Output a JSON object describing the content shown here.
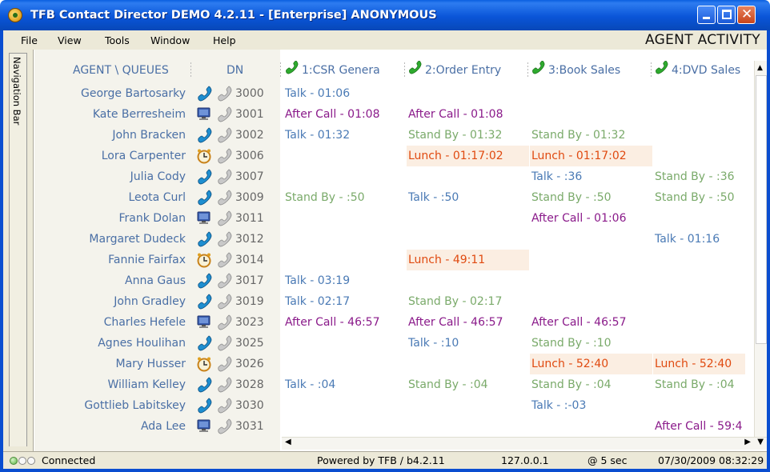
{
  "window": {
    "title": "TFB Contact Director DEMO 4.2.11 - [Enterprise] ANONYMOUS",
    "controls": {
      "minimize": "minimize",
      "maximize": "maximize",
      "close": "✕"
    }
  },
  "menu": {
    "items": [
      "File",
      "View",
      "Tools",
      "Window",
      "Help"
    ],
    "view_title": "AGENT ACTIVITY"
  },
  "navbar": {
    "label": "Navigation Bar"
  },
  "grid": {
    "headers": {
      "agent": "AGENT \\ QUEUES",
      "dn": "DN",
      "queues": [
        "1:CSR Genera",
        "2:Order Entry",
        "3:Book Sales",
        "4:DVD Sales"
      ]
    },
    "rows": [
      {
        "name": "George Bartosarky",
        "status": "phone-blue",
        "dn": "3000",
        "cells": [
          [
            "talk",
            "Talk - 01:06"
          ],
          null,
          null,
          null
        ]
      },
      {
        "name": "Kate Berresheim",
        "status": "monitor",
        "dn": "3001",
        "cells": [
          [
            "after",
            "After Call - 01:08"
          ],
          [
            "after",
            "After Call - 01:08"
          ],
          null,
          null
        ]
      },
      {
        "name": "John Bracken",
        "status": "phone-blue",
        "dn": "3002",
        "cells": [
          [
            "talk",
            "Talk - 01:32"
          ],
          [
            "standby",
            "Stand By - 01:32"
          ],
          [
            "standby",
            "Stand By - 01:32"
          ],
          null
        ]
      },
      {
        "name": "Lora Carpenter",
        "status": "clock",
        "dn": "3006",
        "cells": [
          null,
          [
            "lunch",
            "Lunch - 01:17:02"
          ],
          [
            "lunch",
            "Lunch - 01:17:02"
          ],
          null
        ]
      },
      {
        "name": "Julia Cody",
        "status": "phone-blue",
        "dn": "3007",
        "cells": [
          null,
          null,
          [
            "talk",
            "Talk - :36"
          ],
          [
            "standby",
            "Stand By - :36"
          ]
        ]
      },
      {
        "name": "Leota Curl",
        "status": "phone-blue",
        "dn": "3009",
        "cells": [
          [
            "standby",
            "Stand By - :50"
          ],
          [
            "talk",
            "Talk - :50"
          ],
          [
            "standby",
            "Stand By - :50"
          ],
          [
            "standby",
            "Stand By - :50"
          ]
        ]
      },
      {
        "name": "Frank Dolan",
        "status": "monitor",
        "dn": "3011",
        "cells": [
          null,
          null,
          [
            "after",
            "After Call - 01:06"
          ],
          null
        ]
      },
      {
        "name": "Margaret Dudeck",
        "status": "phone-blue",
        "dn": "3012",
        "cells": [
          null,
          null,
          null,
          [
            "talk",
            "Talk - 01:16"
          ]
        ]
      },
      {
        "name": "Fannie Fairfax",
        "status": "clock",
        "dn": "3014",
        "cells": [
          null,
          [
            "lunch",
            "Lunch - 49:11"
          ],
          null,
          null
        ]
      },
      {
        "name": "Anna Gaus",
        "status": "phone-blue",
        "dn": "3017",
        "cells": [
          [
            "talk",
            "Talk - 03:19"
          ],
          null,
          null,
          null
        ]
      },
      {
        "name": "John Gradley",
        "status": "phone-blue",
        "dn": "3019",
        "cells": [
          [
            "talk",
            "Talk - 02:17"
          ],
          [
            "standby",
            "Stand By - 02:17"
          ],
          null,
          null
        ]
      },
      {
        "name": "Charles Hefele",
        "status": "monitor",
        "dn": "3023",
        "cells": [
          [
            "after",
            "After Call - 46:57"
          ],
          [
            "after",
            "After Call - 46:57"
          ],
          [
            "after",
            "After Call - 46:57"
          ],
          null
        ]
      },
      {
        "name": "Agnes Houlihan",
        "status": "phone-blue",
        "dn": "3025",
        "cells": [
          null,
          [
            "talk",
            "Talk - :10"
          ],
          [
            "standby",
            "Stand By - :10"
          ],
          null
        ]
      },
      {
        "name": "Mary Husser",
        "status": "clock",
        "dn": "3026",
        "cells": [
          null,
          null,
          [
            "lunch",
            "Lunch - 52:40"
          ],
          [
            "lunch",
            "Lunch - 52:40"
          ]
        ]
      },
      {
        "name": "William Kelley",
        "status": "phone-blue",
        "dn": "3028",
        "cells": [
          [
            "talk",
            "Talk - :04"
          ],
          [
            "standby",
            "Stand By - :04"
          ],
          [
            "standby",
            "Stand By - :04"
          ],
          [
            "standby",
            "Stand By - :04"
          ]
        ]
      },
      {
        "name": "Gottlieb Labitskey",
        "status": "phone-blue",
        "dn": "3030",
        "cells": [
          null,
          null,
          [
            "talk",
            "Talk - :-03"
          ],
          null
        ]
      },
      {
        "name": "Ada Lee",
        "status": "monitor",
        "dn": "3031",
        "cells": [
          null,
          null,
          null,
          [
            "after",
            "After Call - 59:4"
          ]
        ]
      }
    ]
  },
  "statusbar": {
    "connection": "Connected",
    "powered": "Powered by TFB / b4.2.11",
    "host": "127.0.0.1",
    "refresh": "@ 5 sec",
    "datetime": "07/30/2009 08:32:29"
  },
  "colors": {
    "talk": "#4a7ab5",
    "after_call": "#8a1a8a",
    "standby": "#7aaa6a",
    "lunch": "#e04a10",
    "lunch_bg": "#fbeee2",
    "agent_text": "#4a6fa5"
  }
}
